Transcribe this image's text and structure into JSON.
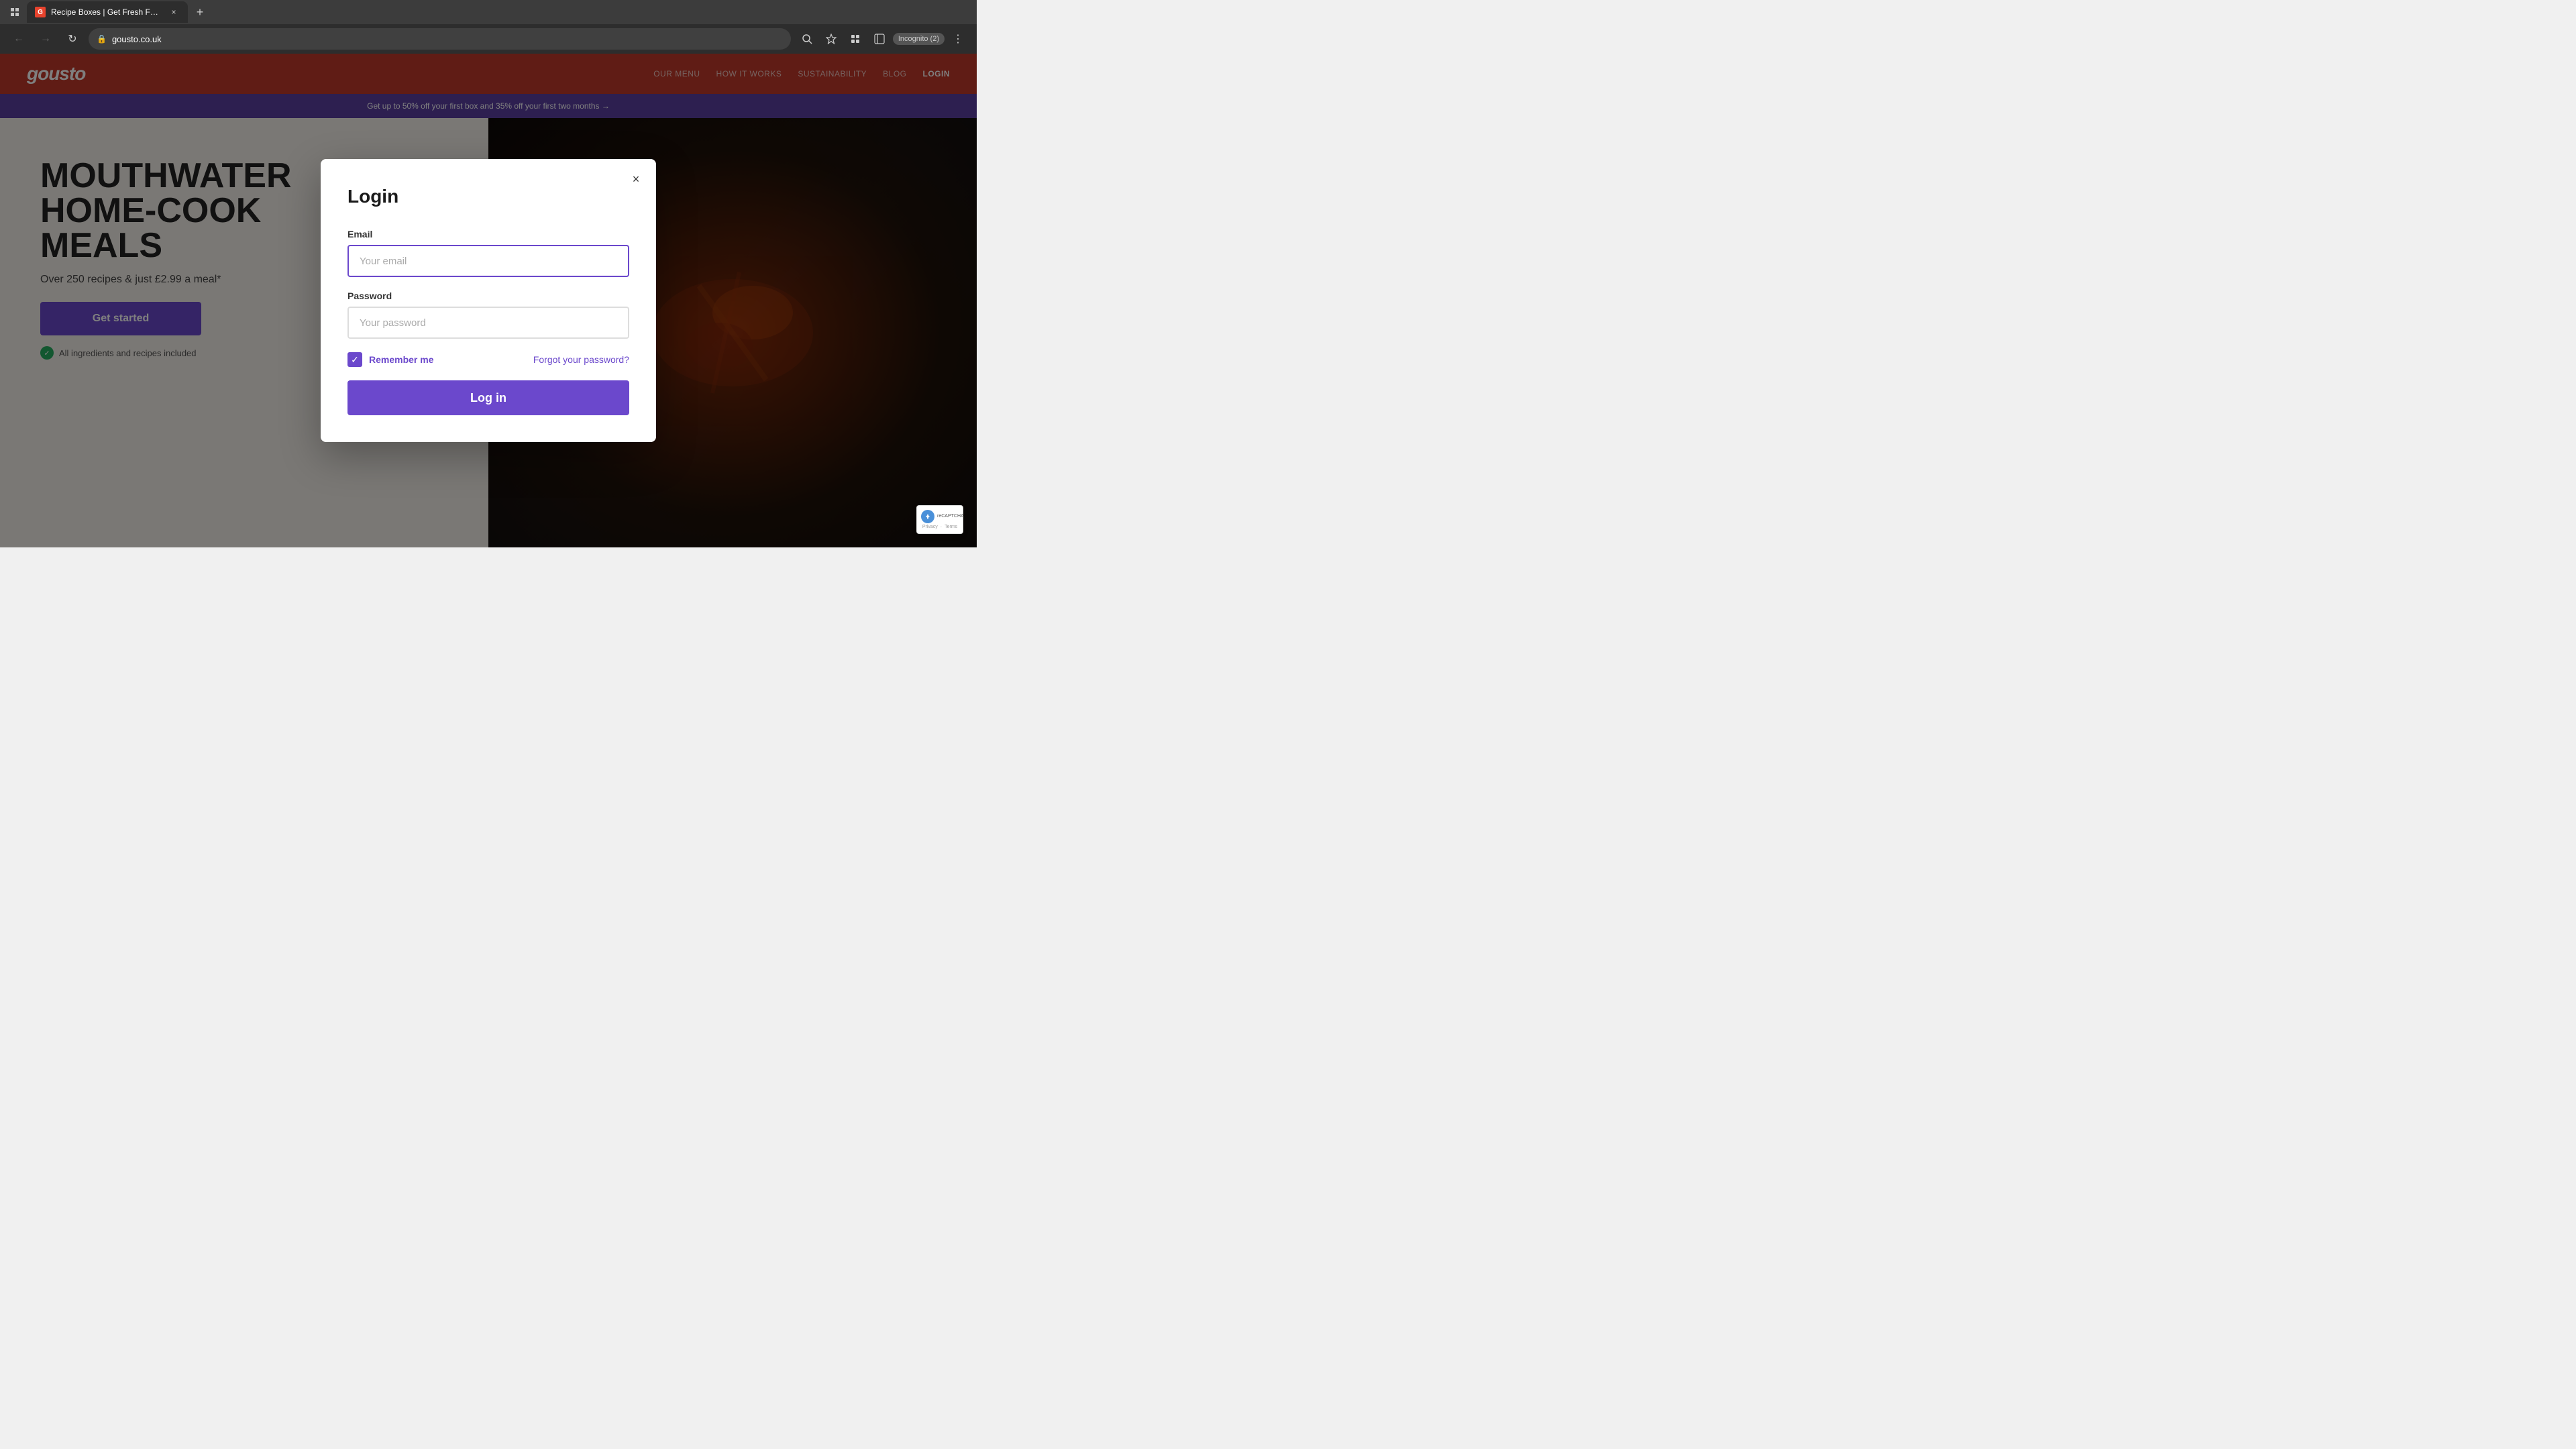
{
  "browser": {
    "tab_title": "Recipe Boxes | Get Fresh Food ...",
    "tab_favicon": "G",
    "url": "gousto.co.uk",
    "incognito_label": "Incognito (2)"
  },
  "header": {
    "logo": "gousto",
    "nav_items": [
      {
        "label": "OUR MENU",
        "active": false
      },
      {
        "label": "HOW IT WORKS",
        "active": false
      },
      {
        "label": "SUSTAINABILITY",
        "active": false
      },
      {
        "label": "BLOG",
        "active": false
      },
      {
        "label": "LOGIN",
        "active": true
      }
    ]
  },
  "promo_banner": {
    "text": "Get up to 50% off your first box and 35% off your first two months  →"
  },
  "hero": {
    "title_line1": "MOUTHWATER",
    "title_line2": "HOME-COOK",
    "title_line3": "MEALS",
    "subtitle": "Over 250 recipes & just £2.99 a meal*",
    "cta_label": "Get started",
    "check_text": "All ingredients and recipes included"
  },
  "modal": {
    "title": "Login",
    "close_label": "×",
    "email_label": "Email",
    "email_placeholder": "Your email",
    "password_label": "Password",
    "password_placeholder": "Your password",
    "remember_label": "Remember me",
    "forgot_label": "Forgot your password?",
    "login_button_label": "Log in"
  },
  "recaptcha": {
    "logo_letter": "rC",
    "line1": "reCAPTCHA",
    "privacy": "Privacy",
    "terms": "Terms"
  }
}
